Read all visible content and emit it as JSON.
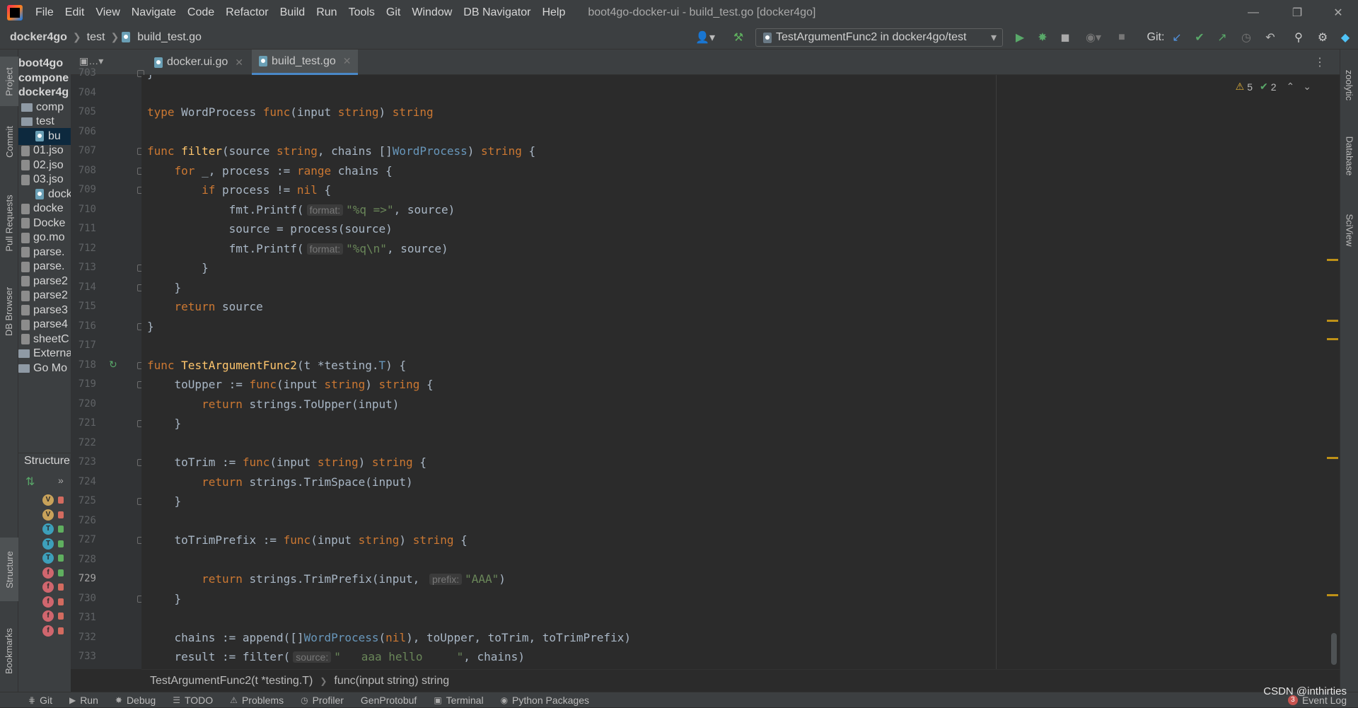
{
  "titlebar": {
    "menus": [
      "File",
      "Edit",
      "View",
      "Navigate",
      "Code",
      "Refactor",
      "Build",
      "Run",
      "Tools",
      "Git",
      "Window",
      "DB Navigator",
      "Help"
    ],
    "title": "boot4go-docker-ui - build_test.go [docker4go]"
  },
  "navbar": {
    "crumbs": [
      "docker4go",
      "test",
      "build_test.go"
    ],
    "run_config": "TestArgumentFunc2 in docker4go/test",
    "git_label": "Git:"
  },
  "tabs": [
    {
      "label": "docker.ui.go",
      "active": false
    },
    {
      "label": "build_test.go",
      "active": true
    }
  ],
  "left_strip": [
    "Project",
    "Commit",
    "Pull Requests",
    "DB Browser",
    "Structure",
    "Bookmarks"
  ],
  "right_strip": [
    "zoolytic",
    "Database",
    "SciView"
  ],
  "project_tree": [
    {
      "label": "boot4go",
      "kind": "module"
    },
    {
      "label": "compone",
      "kind": "module"
    },
    {
      "label": "docker4g",
      "kind": "module"
    },
    {
      "label": "comp",
      "kind": "folder"
    },
    {
      "label": "test",
      "kind": "folder"
    },
    {
      "label": "bu",
      "kind": "gofile"
    },
    {
      "label": "01.jso",
      "kind": "file"
    },
    {
      "label": "02.jso",
      "kind": "file"
    },
    {
      "label": "03.jso",
      "kind": "file"
    },
    {
      "label": "docke",
      "kind": "gofile"
    },
    {
      "label": "docke",
      "kind": "file"
    },
    {
      "label": "Docke",
      "kind": "file"
    },
    {
      "label": "go.mo",
      "kind": "file"
    },
    {
      "label": "parse.",
      "kind": "file"
    },
    {
      "label": "parse.",
      "kind": "file"
    },
    {
      "label": "parse2",
      "kind": "file"
    },
    {
      "label": "parse2",
      "kind": "file"
    },
    {
      "label": "parse3",
      "kind": "file"
    },
    {
      "label": "parse4",
      "kind": "file"
    },
    {
      "label": "sheetC",
      "kind": "file"
    },
    {
      "label": "External L",
      "kind": "lib"
    },
    {
      "label": "Go Mo",
      "kind": "lib"
    }
  ],
  "structure": {
    "title": "Structure",
    "items": [
      {
        "badge": "V",
        "color": "#c8a25a",
        "lock": "#d36b5f"
      },
      {
        "badge": "V",
        "color": "#c8a25a",
        "lock": "#d36b5f"
      },
      {
        "badge": "T",
        "color": "#3d9fba",
        "lock": "#5faf5f"
      },
      {
        "badge": "T",
        "color": "#3d9fba",
        "lock": "#5faf5f"
      },
      {
        "badge": "T",
        "color": "#3d9fba",
        "lock": "#5faf5f"
      },
      {
        "badge": "f",
        "color": "#d0666e",
        "lock": "#5faf5f"
      },
      {
        "badge": "f",
        "color": "#d0666e",
        "lock": "#d36b5f"
      },
      {
        "badge": "f",
        "color": "#d0666e",
        "lock": "#d36b5f"
      },
      {
        "badge": "f",
        "color": "#d0666e",
        "lock": "#d36b5f"
      },
      {
        "badge": "f",
        "color": "#d0666e",
        "lock": "#d36b5f"
      }
    ]
  },
  "inspection": {
    "warnings": "5",
    "ok": "2"
  },
  "code_lines": [
    {
      "n": "703",
      "html": "}"
    },
    {
      "n": "704",
      "html": ""
    },
    {
      "n": "705",
      "html": "<span class='kw'>type</span> WordProcess <span class='kw'>func</span>(input <span class='kw'>string</span>) <span class='kw'>string</span>"
    },
    {
      "n": "706",
      "html": ""
    },
    {
      "n": "707",
      "html": "<span class='kw'>func</span> <span class='fn'>filter</span>(source <span class='kw'>string</span>, chains []<span class='ty'>WordProcess</span>) <span class='kw'>string</span> {"
    },
    {
      "n": "708",
      "html": "    <span class='kw'>for</span> _, process := <span class='kw'>range</span> chains {"
    },
    {
      "n": "709",
      "html": "        <span class='kw'>if</span> process != <span class='kw'>nil</span> {"
    },
    {
      "n": "710",
      "html": "            fmt.Printf(<span class='hint'>format:</span><span class='str'>\"%q =>\"</span>, source)"
    },
    {
      "n": "711",
      "html": "            source = process(source)"
    },
    {
      "n": "712",
      "html": "            fmt.Printf(<span class='hint'>format:</span><span class='str'>\"%q\\n\"</span>, source)"
    },
    {
      "n": "713",
      "html": "        }"
    },
    {
      "n": "714",
      "html": "    }"
    },
    {
      "n": "715",
      "html": "    <span class='kw'>return</span> source"
    },
    {
      "n": "716",
      "html": "}"
    },
    {
      "n": "717",
      "html": ""
    },
    {
      "n": "718",
      "html": "<span class='kw'>func</span> <span class='fn'>TestArgumentFunc2</span>(t *testing.<span class='ty'>T</span>) {"
    },
    {
      "n": "719",
      "html": "    toUpper := <span class='kw'>func</span>(input <span class='kw'>string</span>) <span class='kw'>string</span> {"
    },
    {
      "n": "720",
      "html": "        <span class='kw'>return</span> strings.ToUpper(input)"
    },
    {
      "n": "721",
      "html": "    }"
    },
    {
      "n": "722",
      "html": ""
    },
    {
      "n": "723",
      "html": "    toTrim := <span class='kw'>func</span>(input <span class='kw'>string</span>) <span class='kw'>string</span> {"
    },
    {
      "n": "724",
      "html": "        <span class='kw'>return</span> strings.TrimSpace(input)"
    },
    {
      "n": "725",
      "html": "    }"
    },
    {
      "n": "726",
      "html": ""
    },
    {
      "n": "727",
      "html": "    toTrimPrefix := <span class='kw'>func</span>(input <span class='kw'>string</span>) <span class='kw'>string</span> {"
    },
    {
      "n": "728",
      "html": ""
    },
    {
      "n": "729",
      "html": "        <span class='kw'>return</span> strings.TrimPrefix(input, <span class='hint'>prefix:</span><span class='str'>\"AAA\"</span>)"
    },
    {
      "n": "730",
      "html": "    }"
    },
    {
      "n": "731",
      "html": ""
    },
    {
      "n": "732",
      "html": "    chains := append([]<span class='ty'>WordProcess</span>(<span class='kw'>nil</span>), toUpper, toTrim, toTrimPrefix)"
    },
    {
      "n": "733",
      "html": "    result := filter(<span class='hint'>source:</span><span class='str'>\"   aaa hello     \"</span>, chains)"
    }
  ],
  "breadcrumb": [
    "TestArgumentFunc2(t *testing.T)",
    "func(input string) string"
  ],
  "status": {
    "items": [
      "Git",
      "Run",
      "Debug",
      "TODO",
      "Problems",
      "Profiler",
      "GenProtobuf",
      "Terminal",
      "Python Packages"
    ],
    "event_log": "Event Log",
    "event_count": "3",
    "watermark": "CSDN @inthirties"
  }
}
